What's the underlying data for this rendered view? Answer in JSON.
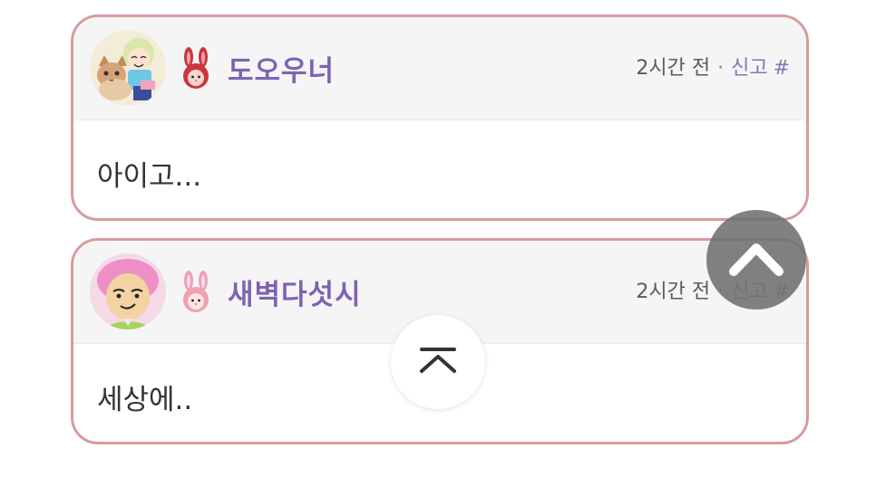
{
  "comments": [
    {
      "username": "도오우너",
      "time": "2시간 전",
      "separator": "·",
      "report_label": "신고",
      "hash_label": "#",
      "body": "아이고...",
      "level_icon": "red-bunny-icon",
      "avatar": "cat-and-character-avatar"
    },
    {
      "username": "새벽다섯시",
      "time": "2시간 전",
      "separator": "·",
      "report_label": "신고",
      "hash_label": "#",
      "body": "세상에..",
      "level_icon": "pink-bunny-icon",
      "avatar": "pink-hair-face-avatar"
    }
  ],
  "controls": {
    "scroll_top_float_icon": "chevron-up-icon",
    "scroll_top_button_icon": "scroll-to-top-icon"
  },
  "colors": {
    "card_border": "#d99a9d",
    "username": "#7d63b3",
    "report_link": "#8a73b8"
  }
}
